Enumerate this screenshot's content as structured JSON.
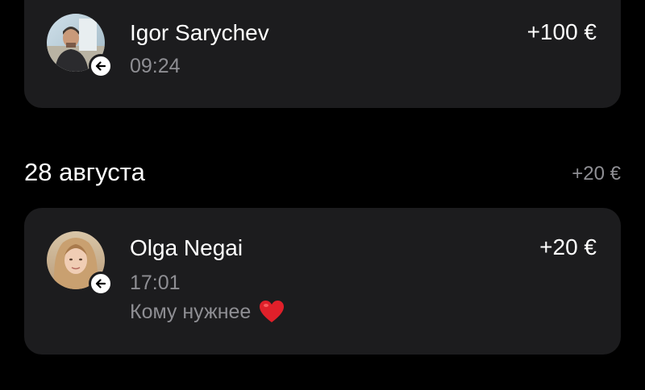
{
  "transactions_top": {
    "name": "Igor Sarychev",
    "time": "09:24",
    "amount": "+100 €",
    "direction_icon": "arrow-left-icon"
  },
  "section": {
    "date": "28 августа",
    "total": "+20 €"
  },
  "transactions_bottom": {
    "name": "Olga Negai",
    "time": "17:01",
    "comment": "Кому нужнее",
    "comment_emoji": "heart-icon",
    "amount": "+20 €",
    "direction_icon": "arrow-left-icon"
  },
  "colors": {
    "background": "#000000",
    "card": "#1c1c1e",
    "primary_text": "#ffffff",
    "secondary_text": "#8e8e93",
    "heart": "#e0202a"
  }
}
